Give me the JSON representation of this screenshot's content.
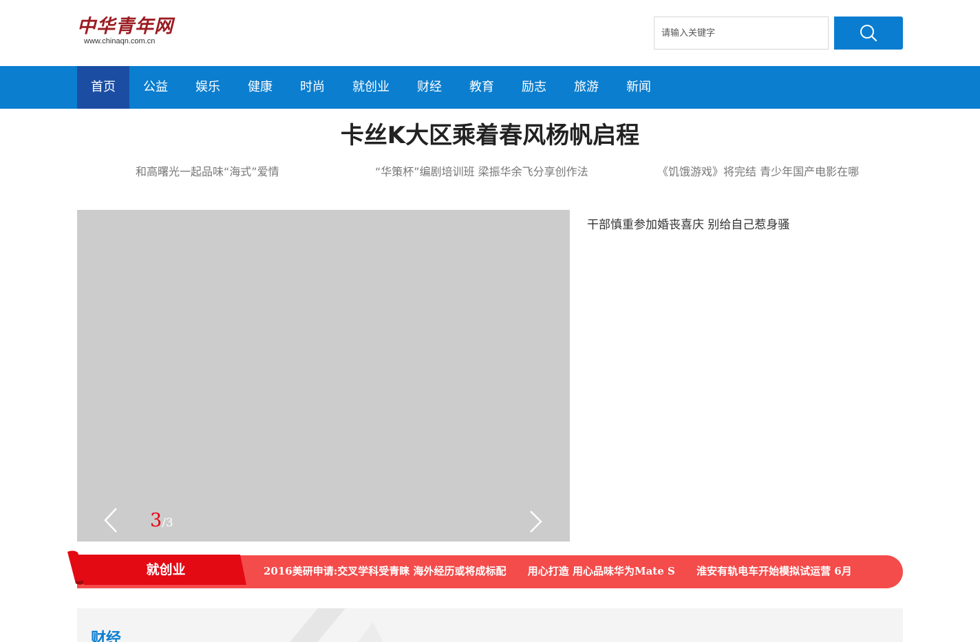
{
  "logo": {
    "main": "中华青年网",
    "sub": "www.chinaqn.com.cn"
  },
  "search": {
    "placeholder": "请输入关键字"
  },
  "nav": {
    "items": [
      "首页",
      "公益",
      "娱乐",
      "健康",
      "时尚",
      "就创业",
      "财经",
      "教育",
      "励志",
      "旅游",
      "新闻"
    ],
    "active": "首页"
  },
  "headline": {
    "title": "卡丝K大区乘着春风杨帆启程",
    "sub_links": [
      "和高曙光一起品味“海式”爱情",
      "“华策杯”编剧培训班 梁振华余飞分享创作法",
      "《饥饿游戏》将完结 青少年国产电影在哪"
    ]
  },
  "slider": {
    "current": "3",
    "separator": "/",
    "total": "3"
  },
  "side_news": {
    "title": "干部慎重参加婚丧喜庆 别给自己惹身骚"
  },
  "ticker": {
    "label": "就创业",
    "items": [
      "2016美研申请:交叉学科受青睐 海外经历或将成标配",
      "用心打造 用心品味华为Mate S",
      "淮安有轨电车开始模拟试运营 6月"
    ]
  },
  "section": {
    "title": "财经"
  },
  "colors": {
    "primary_blue": "#0b7ecf",
    "nav_active": "#1b4ea3",
    "ticker_red": "#f44b4b",
    "label_red": "#e30a14",
    "logo_red": "#9b1c22"
  }
}
